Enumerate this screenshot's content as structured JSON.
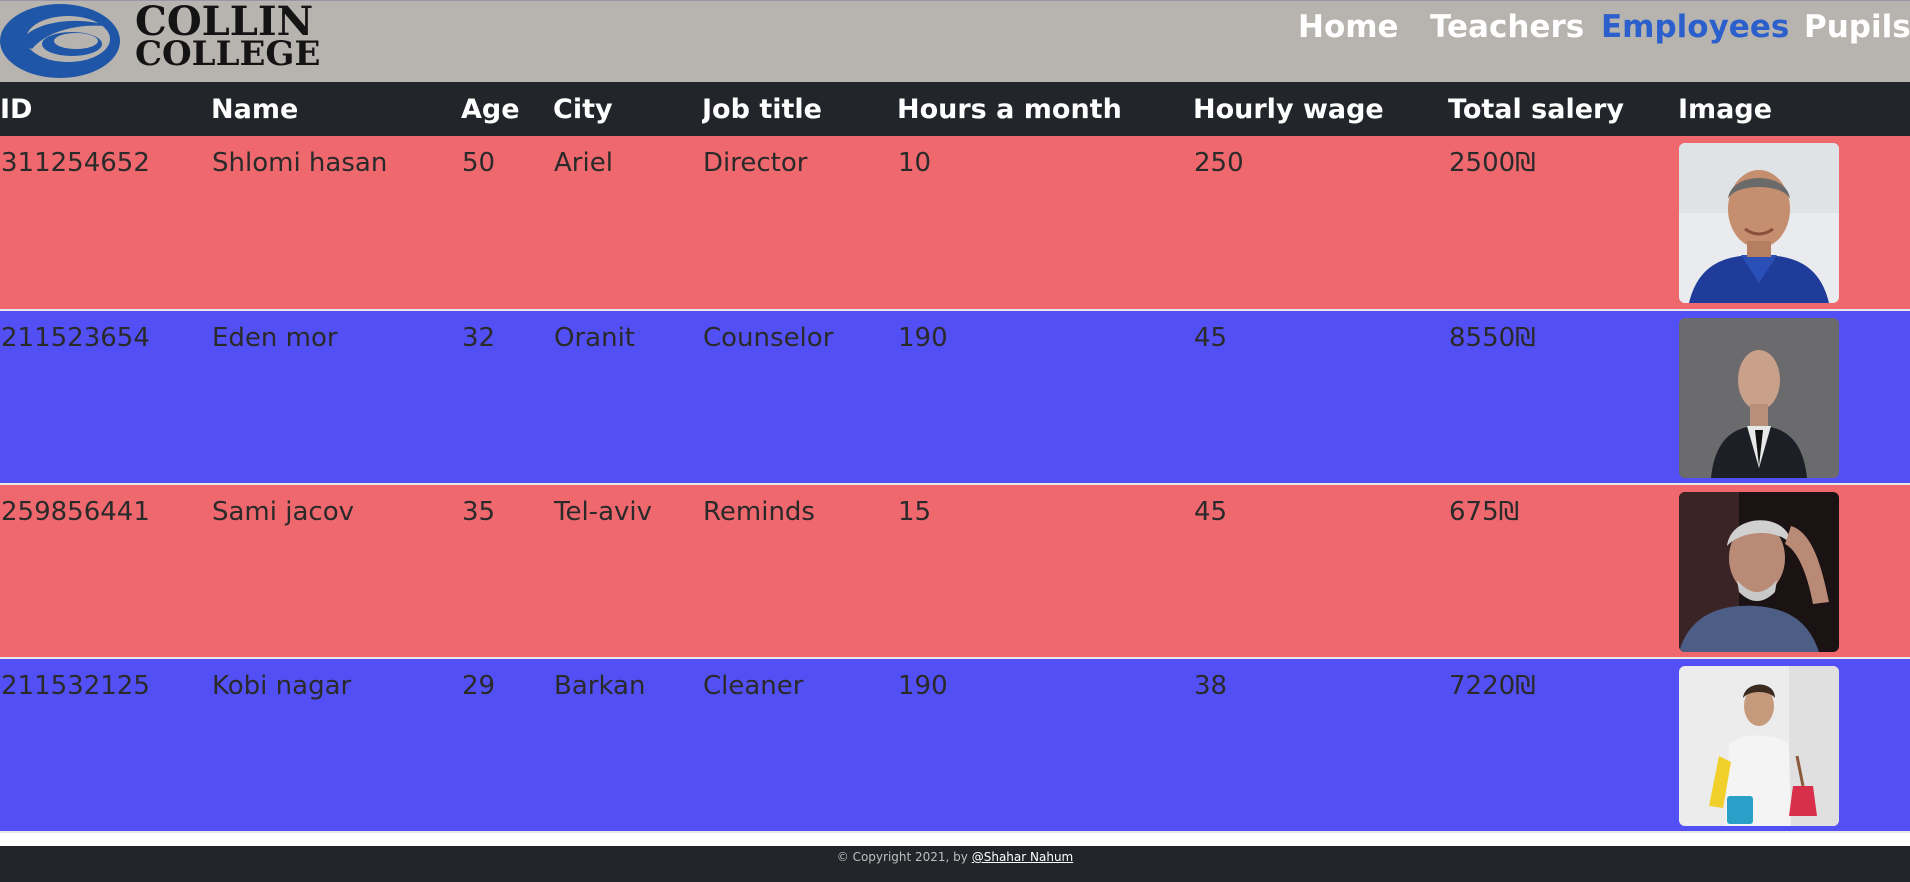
{
  "brand": {
    "line1": "COLLIN",
    "line2": "COLLEGE"
  },
  "nav": {
    "items": [
      {
        "label": "Home",
        "active": false
      },
      {
        "label": "Teachers",
        "active": false
      },
      {
        "label": "Employees",
        "active": true
      },
      {
        "label": "Pupils",
        "active": false
      }
    ]
  },
  "table": {
    "headers": [
      "ID",
      "Name",
      "Age",
      "City",
      "Job title",
      "Hours a month",
      "Hourly wage",
      "Total salery",
      "Image"
    ],
    "rows": [
      {
        "id": "311254652",
        "name": "Shlomi hasan",
        "age": "50",
        "city": "Ariel",
        "job": "Director",
        "hours": "10",
        "wage": "250",
        "total": "2500₪",
        "image": "photo-man-blue-shirt"
      },
      {
        "id": "211523654",
        "name": "Eden mor",
        "age": "32",
        "city": "Oranit",
        "job": "Counselor",
        "hours": "190",
        "wage": "45",
        "total": "8550₪",
        "image": "photo-man-suit"
      },
      {
        "id": "259856441",
        "name": "Sami jacov",
        "age": "35",
        "city": "Tel-aviv",
        "job": "Reminds",
        "hours": "15",
        "wage": "45",
        "total": "675₪",
        "image": "photo-man-thinking"
      },
      {
        "id": "211532125",
        "name": "Kobi nagar",
        "age": "29",
        "city": "Barkan",
        "job": "Cleaner",
        "hours": "190",
        "wage": "38",
        "total": "7220₪",
        "image": "photo-man-cleaning"
      }
    ],
    "colors": {
      "header_bg": "#222529",
      "row_red": "#ee686e",
      "row_blue": "#5250f5"
    }
  },
  "footer": {
    "text": "© Copyright 2021, by ",
    "link": "@Shahar Nahum"
  },
  "colors": {
    "header_bg": "#b7b4af",
    "nav_active": "#2b5fcc",
    "logo_blue": "#1f56a8"
  }
}
